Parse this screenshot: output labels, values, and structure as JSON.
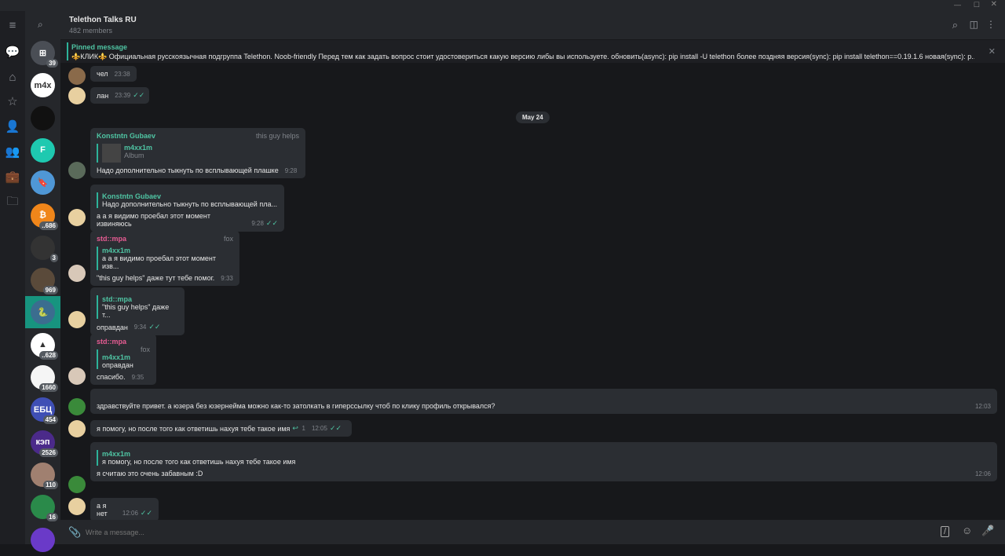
{
  "header": {
    "title": "Telethon Talks RU",
    "members": "482 members"
  },
  "pinned": {
    "label": "Pinned message",
    "text": "⚜️КЛИК⚜️ Официальная русскоязычная подгруппа Telethon. Noob-friendly Перед тем как задать вопрос стоит удостовериться какую версию либы вы используете.  обновить(async): pip install -U telethon более поздняя версия(sync): pip install telethon==0.19.1.6 новая(sync): p..."
  },
  "chat_list": [
    {
      "label": "⊞",
      "badge": "39",
      "color": "#4a4e55"
    },
    {
      "label": "m4x",
      "badge": "",
      "color": "#ffffff"
    },
    {
      "label": "",
      "badge": "",
      "color": "#111111"
    },
    {
      "label": "F",
      "badge": "",
      "color": "#1ec9b0"
    },
    {
      "label": "🔖",
      "badge": "",
      "color": "#4f97d6"
    },
    {
      "label": "₿",
      "badge": "..686",
      "color": "#f0861a"
    },
    {
      "label": "",
      "badge": "3",
      "color": "#333333"
    },
    {
      "label": "",
      "badge": "969",
      "color": "#5a4a3a"
    },
    {
      "label": "🐍",
      "badge": "",
      "color": "#3b6d8f"
    },
    {
      "label": "▲",
      "badge": "..628",
      "color": "#ffffff"
    },
    {
      "label": "",
      "badge": "1660",
      "color": "#f5f5f5"
    },
    {
      "label": "ЕБЦ",
      "badge": "454",
      "color": "#3f4fb5"
    },
    {
      "label": "кэп",
      "badge": "2526",
      "color": "#4b2a8a"
    },
    {
      "label": "",
      "badge": "110",
      "color": "#a08070"
    },
    {
      "label": "",
      "badge": "16",
      "color": "#2a8a4a"
    },
    {
      "label": "",
      "badge": "",
      "color": "#6a3ac8"
    }
  ],
  "date_separator": "May 24",
  "messages": [
    {
      "text": "чел",
      "time": "23:38"
    },
    {
      "text": "лан",
      "time": "23:39",
      "read": "✓✓"
    },
    {
      "sender": "Konstntn Gubaev",
      "admin": "this guy helps",
      "reply_name": "m4xx1m",
      "reply_text": "Album",
      "text": "Надо дополнительно тыкнуть по всплывающей плашке",
      "time": "9:28"
    },
    {
      "reply_name": "Konstntn Gubaev",
      "reply_text": "Надо дополнительно тыкнуть по всплывающей пла...",
      "text": "а а я видимо проебал этот момент извиняюсь",
      "time": "9:28",
      "read": "✓✓"
    },
    {
      "sender": "std::mpa",
      "admin": "fox",
      "reply_name": "m4xx1m",
      "reply_text": "а а я видимо проебал этот момент изв...",
      "text": "\"this guy helps\" даже тут тебе помог.",
      "time": "9:33"
    },
    {
      "reply_name": "std::mpa",
      "reply_text": "\"this guy helps\" даже т...",
      "text": "оправдан",
      "time": "9:34",
      "read": "✓✓"
    },
    {
      "sender": "std::mpa",
      "admin": "fox",
      "reply_name": "m4xx1m",
      "reply_text": "оправдан",
      "text": "спасибо.",
      "time": "9:35"
    },
    {
      "text": "здравствуйте привет. а юзера без юзернейма можно как-то затолкать в гиперссылку чтоб по клику профиль открывался?",
      "time": "12:03"
    },
    {
      "text": "я помогу, но после того как ответишь нахуя тебе такое имя",
      "replies": "1",
      "time": "12:05",
      "read": "✓✓"
    },
    {
      "reply_name": "m4xx1m",
      "reply_text": "я помогу, но после того как ответишь нахуя тебе такое имя",
      "text": "я считаю это очень забавным :D",
      "time": "12:06"
    },
    {
      "text": "а я нет",
      "time": "12:06",
      "read": "✓✓"
    }
  ],
  "input": {
    "placeholder": "Write a message..."
  },
  "colors": {
    "accent": "#4fc4a3",
    "pink": "#e85c94",
    "bubble": "#2b2e33"
  }
}
